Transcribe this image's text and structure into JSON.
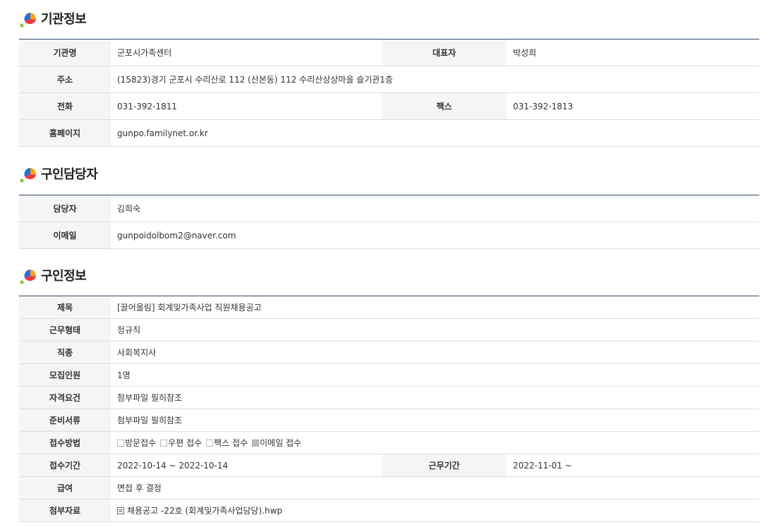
{
  "org": {
    "title": "기관정보",
    "name_label": "기관명",
    "name": "군포시가족센터",
    "rep_label": "대표자",
    "rep": "박성희",
    "addr_label": "주소",
    "addr": "(15823)경기 군포시 수리산로 112 (산본동) 112 수리산상상마을 슬기관1층",
    "tel_label": "전화",
    "tel": "031-392-1811",
    "fax_label": "팩스",
    "fax": "031-392-1813",
    "home_label": "홈페이지",
    "home": "gunpo.familynet.or.kr"
  },
  "contact": {
    "title": "구인담당자",
    "manager_label": "담당자",
    "manager": "김희숙",
    "email_label": "이메일",
    "email": "gunpoidolbom2@naver.com"
  },
  "job": {
    "title": "구인정보",
    "subject_label": "제목",
    "subject": "[끌어올림] 회계및가족사업 직원채용공고",
    "worktype_label": "근무형태",
    "worktype": "정규직",
    "category_label": "직종",
    "category": "사회복지사",
    "headcount_label": "모집인원",
    "headcount": "1명",
    "qual_label": "자격요건",
    "qual": "첨부파일 필히참조",
    "docs_label": "준비서류",
    "docs": "첨부파일 필히참조",
    "method_label": "접수방법",
    "methods": [
      {
        "label": "방문접수",
        "checked": false
      },
      {
        "label": "우편 접수",
        "checked": false
      },
      {
        "label": "팩스 접수",
        "checked": false
      },
      {
        "label": "이메일 접수",
        "checked": true
      }
    ],
    "period_label": "접수기간",
    "period": "2022-10-14 ~ 2022-10-14",
    "workperiod_label": "근무기간",
    "workperiod": "2022-11-01 ~",
    "salary_label": "급여",
    "salary": "면접 후 결정",
    "attach_label": "첨부자료",
    "attach": "채용공고 -22호 (회계및가족사업담당).hwp"
  },
  "colors": {
    "accent_border": "#2d4a6b",
    "header_bg": "#f5f5f5"
  }
}
